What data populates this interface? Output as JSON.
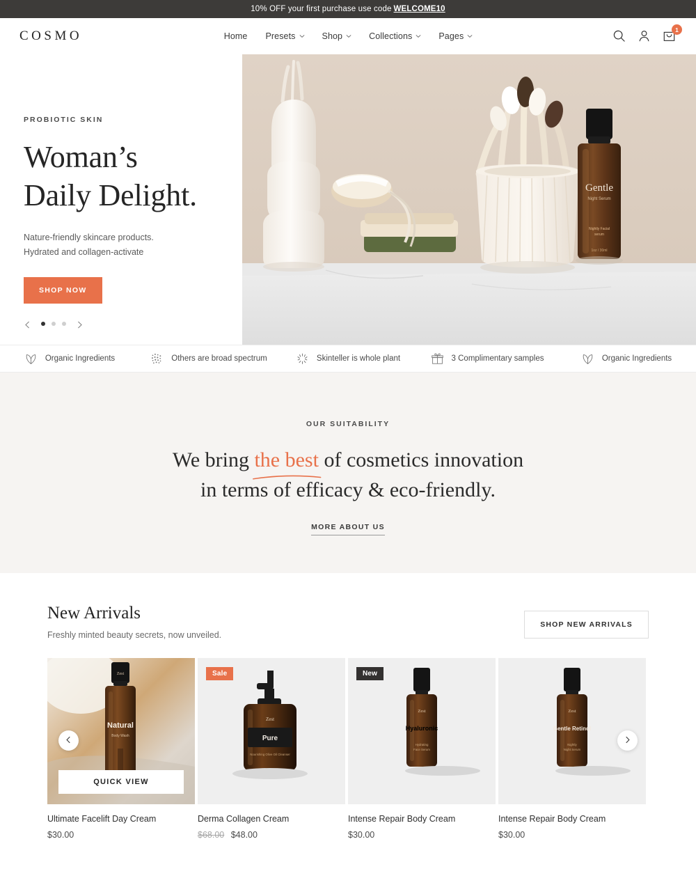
{
  "announcement": {
    "text": "10% OFF your first purchase use code",
    "code": "WELCOME10"
  },
  "header": {
    "logo": "COSMO",
    "nav": [
      {
        "label": "Home",
        "has_dropdown": false
      },
      {
        "label": "Presets",
        "has_dropdown": true
      },
      {
        "label": "Shop",
        "has_dropdown": true
      },
      {
        "label": "Collections",
        "has_dropdown": true
      },
      {
        "label": "Pages",
        "has_dropdown": true
      }
    ],
    "actions": {
      "search": "search-icon",
      "account": "account-icon",
      "cart": "cart-icon",
      "cart_count": "1"
    }
  },
  "hero": {
    "eyebrow": "PROBIOTIC SKIN",
    "title_line1": "Woman’s",
    "title_line2": "Daily Delight.",
    "sub_line1": "Nature-friendly skincare products.",
    "sub_line2": "Hydrated and collagen-activate",
    "cta": "SHOP NOW",
    "slides": 3,
    "active_slide": 1,
    "prev": "chevron-left-icon",
    "next": "chevron-right-icon"
  },
  "features": [
    {
      "icon": "leaf-icon",
      "label": "Organic Ingredients"
    },
    {
      "icon": "dots-icon",
      "label": "Others are broad spectrum"
    },
    {
      "icon": "sparkle-icon",
      "label": "Skinteller is whole plant"
    },
    {
      "icon": "gift-icon",
      "label": "3 Complimentary samples"
    },
    {
      "icon": "leaf-icon",
      "label": "Organic Ingredients"
    }
  ],
  "suitability": {
    "eyebrow": "OUR SUITABILITY",
    "head_before": "We bring ",
    "head_highlight": "the best",
    "head_after": " of cosmetics innovation",
    "head_line2": "in terms of efficacy & eco-friendly.",
    "link": "MORE ABOUT US"
  },
  "arrivals": {
    "title": "New Arrivals",
    "subtitle": "Freshly minted beauty secrets, now unveiled.",
    "cta": "SHOP NEW ARRIVALS",
    "quick_view": "QUICK VIEW",
    "prev": "chevron-left-icon",
    "next": "chevron-right-icon",
    "products": [
      {
        "name": "Ultimate Facelift Day Cream",
        "price": "$30.00",
        "old_price": "",
        "badge": "",
        "bottle_label": "Natural",
        "bottle_sub": "Body Wash",
        "brand": "Zest"
      },
      {
        "name": "Derma Collagen Cream",
        "price": "$48.00",
        "old_price": "$68.00",
        "badge": "Sale",
        "bottle_label": "Pure",
        "bottle_sub": "Olive Oil Cleanser",
        "brand": "Zest"
      },
      {
        "name": "Intense Repair Body Cream",
        "price": "$30.00",
        "old_price": "",
        "badge": "New",
        "bottle_label": "Hyaluronic",
        "bottle_sub": "Face Serum",
        "brand": "Zest"
      },
      {
        "name": "Intense Repair Body Cream",
        "price": "$30.00",
        "old_price": "",
        "badge": "",
        "bottle_label": "Gentle Retinol",
        "bottle_sub": "Night Serum",
        "brand": "Zest"
      }
    ]
  },
  "colors": {
    "accent": "#e8714a",
    "dark": "#3d3b39",
    "suit_bg": "#f6f4f2",
    "card_bg": "#efefef"
  }
}
